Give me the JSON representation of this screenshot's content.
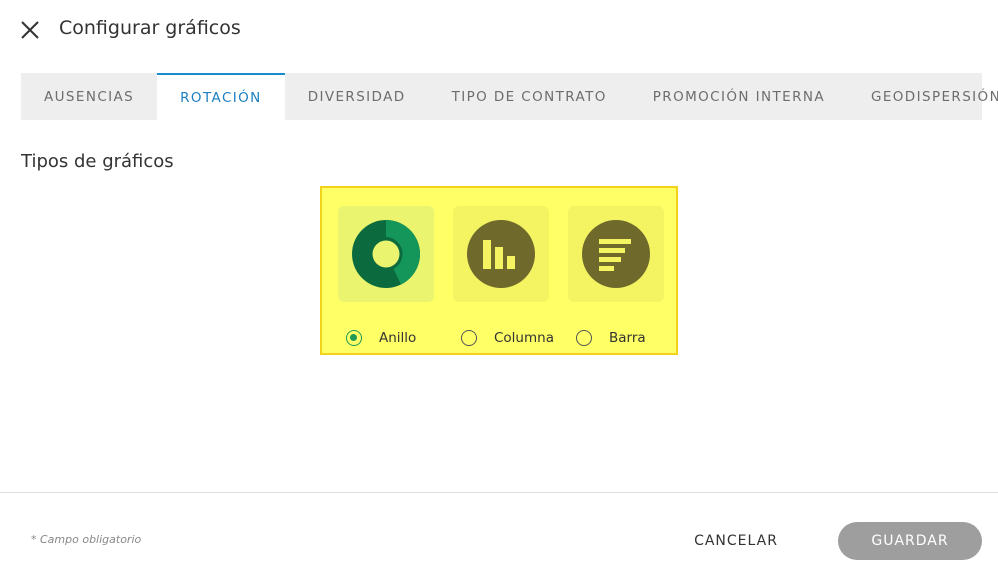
{
  "header": {
    "title": "Configurar gráficos",
    "close_icon": "close-icon"
  },
  "tabs": [
    {
      "label": "AUSENCIAS",
      "active": false
    },
    {
      "label": "ROTACIÓN",
      "active": true
    },
    {
      "label": "DIVERSIDAD",
      "active": false
    },
    {
      "label": "TIPO DE CONTRATO",
      "active": false
    },
    {
      "label": "PROMOCIÓN INTERNA",
      "active": false
    },
    {
      "label": "GEODISPERSIÓN",
      "active": false
    }
  ],
  "section": {
    "title": "Tipos de gráficos"
  },
  "chart_types": {
    "options": [
      {
        "label": "Anillo",
        "icon": "donut-chart-icon",
        "selected": true
      },
      {
        "label": "Columna",
        "icon": "column-chart-icon",
        "selected": false
      },
      {
        "label": "Barra",
        "icon": "bar-chart-icon",
        "selected": false
      }
    ]
  },
  "footer": {
    "required_note": "* Campo obligatorio",
    "cancel_label": "CANCELAR",
    "save_label": "GUARDAR"
  },
  "colors": {
    "accent": "#1b8bd0",
    "highlight": "#ffff66",
    "highlight_border": "#f2d21a",
    "radio_checked": "#1e9a55",
    "save_button": "#9e9e9e",
    "donut_dark": "#0b6b3e",
    "donut_light": "#14955a",
    "icon_olive": "#6f6a2b"
  }
}
